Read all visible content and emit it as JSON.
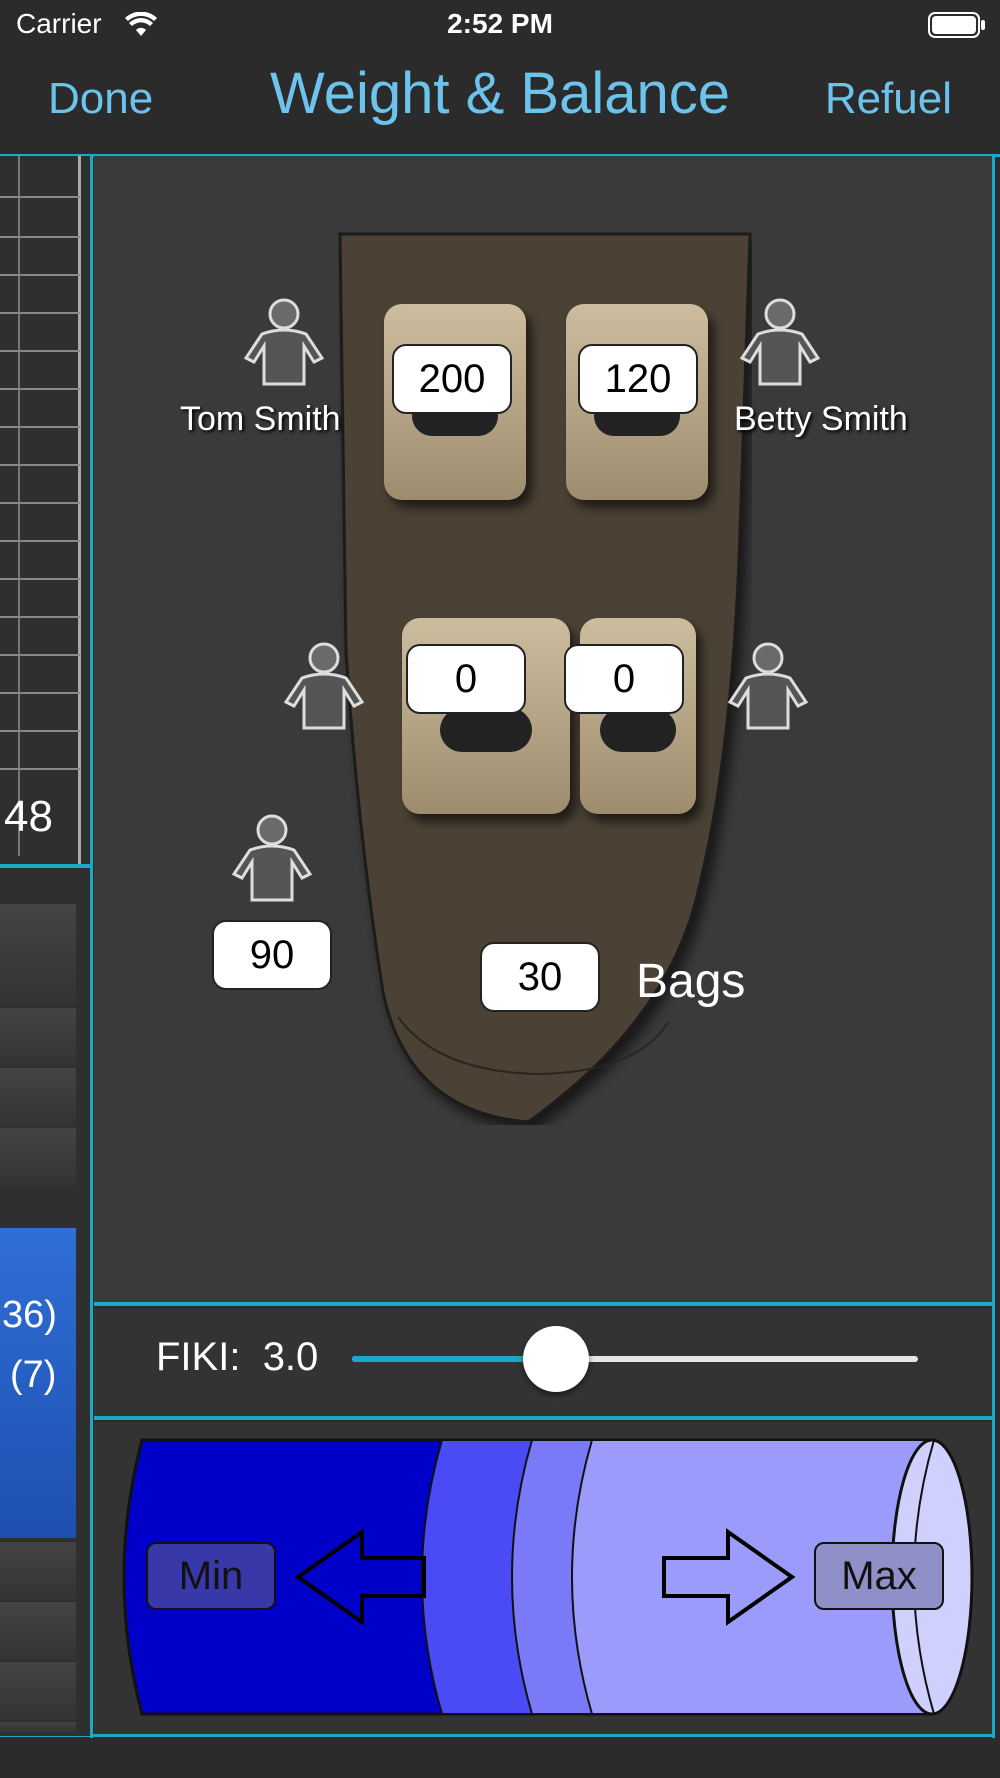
{
  "status": {
    "carrier": "Carrier",
    "time": "2:52 PM"
  },
  "nav": {
    "done": "Done",
    "title": "Weight & Balance",
    "refuel": "Refuel"
  },
  "left_strip": {
    "scale_number": "48",
    "item1": "36)",
    "item2": "(7)"
  },
  "seats": {
    "front_left": "200",
    "front_right": "120",
    "rear_left": "0",
    "rear_right": "0",
    "extra": "90",
    "bags": "30"
  },
  "labels": {
    "front_left_name": "Tom Smith",
    "front_right_name": "Betty Smith",
    "bags_label": "Bags"
  },
  "slider": {
    "label": "FIKI:",
    "value": "3.0",
    "level": 0.36
  },
  "fuel": {
    "min_label": "Min",
    "max_label": "Max"
  },
  "colors": {
    "accent": "#1aa9c6",
    "title": "#6cc4ee"
  }
}
